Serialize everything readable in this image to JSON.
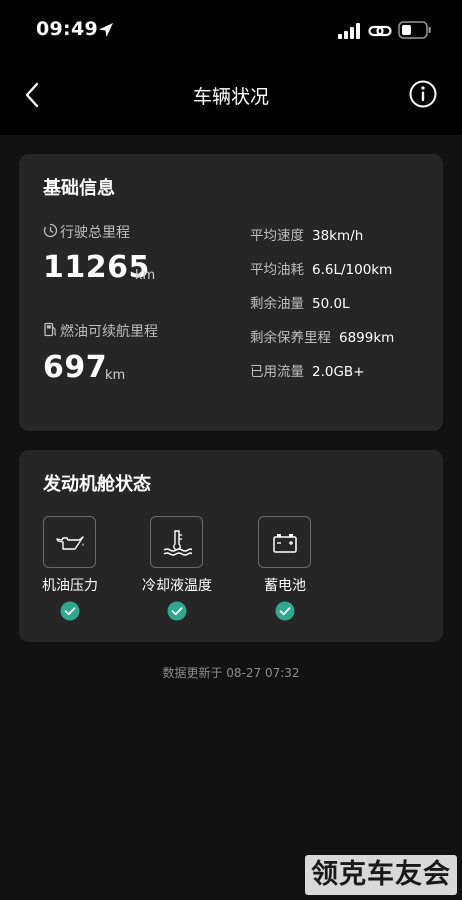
{
  "status_bar": {
    "time": "09:49",
    "icons": [
      "location-arrow-icon",
      "signal-bars-icon",
      "link-icon",
      "battery-icon"
    ]
  },
  "nav": {
    "title": "车辆状况",
    "back_icon": "chevron-left-icon",
    "info_icon": "info-circle-icon"
  },
  "basic_info": {
    "title": "基础信息",
    "total_mileage": {
      "label": "行驶总里程",
      "value": "11265",
      "unit": "km",
      "icon": "timer-icon"
    },
    "fuel_range": {
      "label": "燃油可续航里程",
      "value": "697",
      "unit": "km",
      "icon": "fuel-pump-icon"
    },
    "stats": [
      {
        "label": "平均速度",
        "value": "38km/h"
      },
      {
        "label": "平均油耗",
        "value": "6.6L/100km"
      },
      {
        "label": "剩余油量",
        "value": "50.0L"
      },
      {
        "label": "剩余保养里程",
        "value": "6899km"
      },
      {
        "label": "已用流量",
        "value": "2.0GB+"
      }
    ]
  },
  "engine_status": {
    "title": "发动机舱状态",
    "items": [
      {
        "label": "机油压力",
        "icon": "oil-can-icon",
        "status": "ok"
      },
      {
        "label": "冷却液温度",
        "icon": "coolant-temperature-icon",
        "status": "ok"
      },
      {
        "label": "蓄电池",
        "icon": "car-battery-icon",
        "status": "ok"
      }
    ]
  },
  "update_text": "数据更新于 08-27 07:32",
  "watermark": "领克车友会",
  "colors": {
    "background": "#121212",
    "card": "#262626",
    "check": "#2fa88e"
  }
}
